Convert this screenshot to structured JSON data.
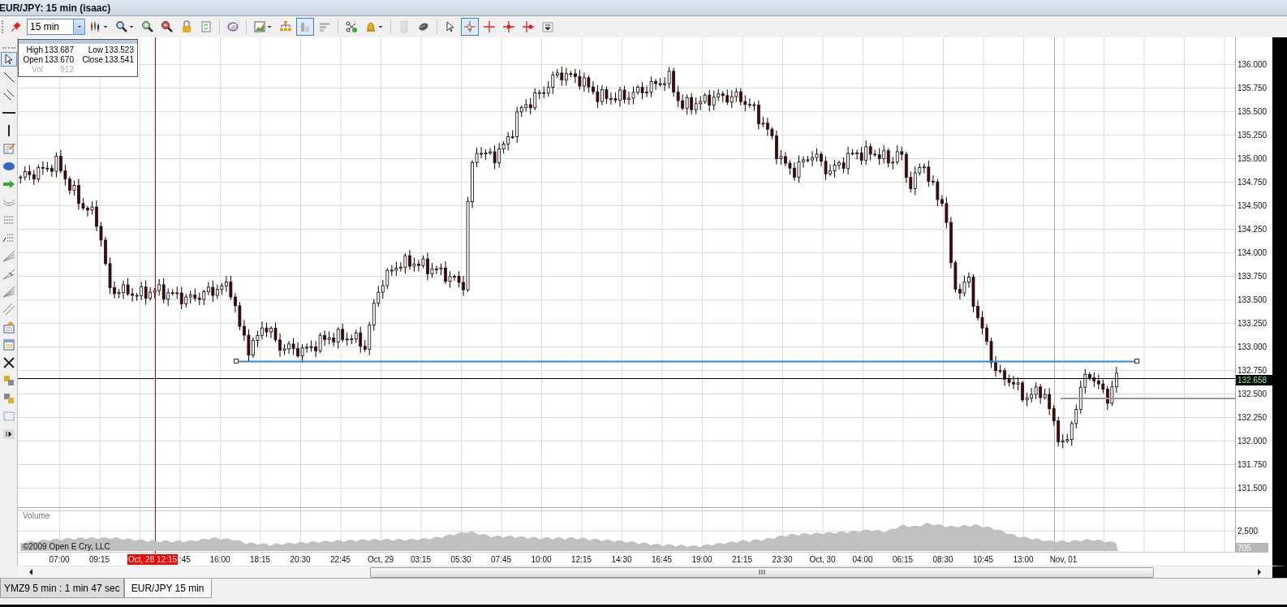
{
  "window": {
    "title": "EUR/JPY: 15 min (isaac)"
  },
  "toolbar": {
    "interval": "15 min",
    "tools": [
      {
        "selected": false,
        "disabled": false
      },
      {
        "selected": false,
        "disabled": false
      },
      {
        "selected": false,
        "disabled": false
      },
      {
        "selected": false,
        "disabled": false
      },
      {
        "selected": false,
        "disabled": false
      },
      {
        "selected": false,
        "disabled": false
      },
      {
        "selected": false,
        "disabled": false
      },
      {
        "selected": false,
        "disabled": false
      },
      {
        "selected": false,
        "disabled": false
      },
      {
        "selected": false,
        "disabled": false
      },
      {
        "selected": true,
        "disabled": false
      },
      {
        "selected": false,
        "disabled": true
      },
      {
        "selected": false,
        "disabled": false
      },
      {
        "selected": false,
        "disabled": false
      },
      {
        "selected": false,
        "disabled": true
      },
      {
        "selected": false,
        "disabled": false
      },
      {
        "selected": false,
        "disabled": false
      },
      {
        "selected": true,
        "disabled": false
      },
      {
        "selected": false,
        "disabled": false
      },
      {
        "selected": false,
        "disabled": false
      },
      {
        "selected": false,
        "disabled": false
      },
      {
        "selected": false,
        "disabled": false
      }
    ]
  },
  "drawing_tools": [
    {
      "selected": true
    },
    {
      "selected": false
    },
    {
      "selected": false
    },
    {
      "selected": false
    },
    {
      "selected": false
    },
    {
      "selected": false
    },
    {
      "selected": false
    },
    {
      "selected": false
    },
    {
      "selected": false
    },
    {
      "selected": false
    },
    {
      "selected": false
    },
    {
      "selected": false
    },
    {
      "selected": false
    },
    {
      "selected": false
    },
    {
      "selected": false
    },
    {
      "selected": false
    },
    {
      "selected": false
    },
    {
      "selected": false
    },
    {
      "selected": false
    },
    {
      "selected": false
    },
    {
      "selected": false
    },
    {
      "selected": false
    }
  ],
  "ohlc": [
    {
      "label": "High",
      "value": "133.687",
      "dimmed": false
    },
    {
      "label": "Low",
      "value": "133.523",
      "dimmed": false
    },
    {
      "label": "Open",
      "value": "133.670",
      "dimmed": false
    },
    {
      "label": "Close",
      "value": "133.541",
      "dimmed": false
    },
    {
      "label": "Vol",
      "value": "912",
      "dimmed": true
    }
  ],
  "price_axis": {
    "labels": [
      "136.000",
      "135.750",
      "135.500",
      "135.250",
      "135.000",
      "134.750",
      "134.500",
      "134.250",
      "134.000",
      "133.750",
      "133.500",
      "133.250",
      "133.000",
      "132.750",
      "132.500",
      "132.250",
      "132.000",
      "131.750",
      "131.500"
    ],
    "last_price": "132.658"
  },
  "volume_pane": {
    "title": "Volume",
    "copyright": "©2009 Open E Cry, LLC",
    "axis_label": "2,500",
    "last_volume": "705"
  },
  "time_axis": {
    "crosshair_time": "Oct, 28 12:15",
    "labels": [
      "07:00",
      "09:15",
      ":45",
      "16:00",
      "18:15",
      "20:30",
      "22:45",
      "Oct, 29",
      "03:15",
      "05:30",
      "07:45",
      "10:00",
      "12:15",
      "14:30",
      "16:45",
      "19:00",
      "21:15",
      "23:30",
      "Oct, 30",
      "04:00",
      "06:15",
      "08:30",
      "10:45",
      "13:00",
      "Nov, 01"
    ]
  },
  "tabs": [
    {
      "label": "YMZ9 5 min : 1 min 47 sec",
      "selected": false
    },
    {
      "label": "EUR/JPY 15 min",
      "selected": true
    }
  ]
}
